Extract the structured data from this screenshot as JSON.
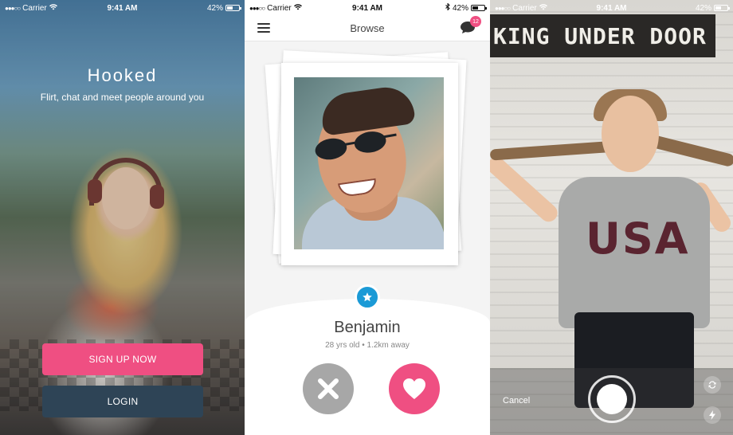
{
  "status_bar": {
    "carrier": "Carrier",
    "time": "9:41 AM",
    "battery": "42%"
  },
  "onboarding": {
    "app_name": "Hooked",
    "tagline": "Flirt, chat and meet people around you",
    "signup_label": "SIGN UP NOW",
    "login_label": "LOGIN",
    "accent_color": "#ef4f82",
    "secondary_color": "#2e4456"
  },
  "browse": {
    "title": "Browse",
    "unread_count": "12",
    "profile": {
      "name": "Benjamin",
      "details": "28 yrs old • 1.2km away"
    },
    "icons": {
      "menu": "hamburger-icon",
      "chat": "chat-bubble-icon",
      "favorite": "star-icon",
      "reject": "close-icon",
      "like": "heart-icon"
    }
  },
  "camera": {
    "sign_text": "KING UNDER DOOR",
    "shirt_text": "USA",
    "cancel_label": "Cancel",
    "icons": {
      "flip": "camera-flip-icon",
      "flash": "flash-icon",
      "shutter": "shutter-button"
    }
  }
}
